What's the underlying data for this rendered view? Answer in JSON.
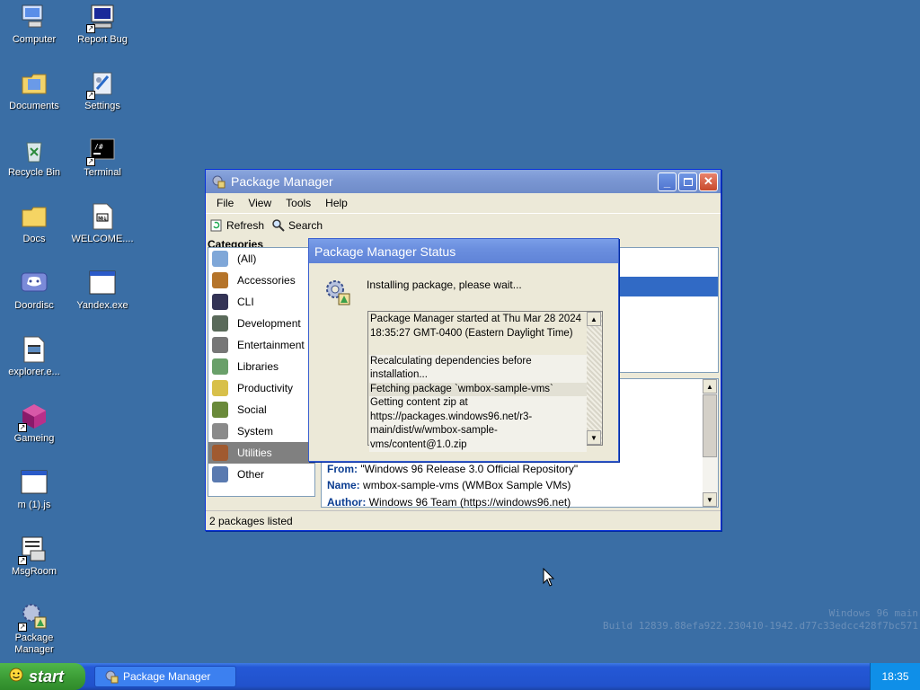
{
  "desktop": {
    "icons": [
      {
        "label": "Computer",
        "icon": "computer-icon",
        "shortcut": false
      },
      {
        "label": "Report Bug",
        "icon": "monitor-icon",
        "shortcut": true
      },
      {
        "label": "Documents",
        "icon": "documents-folder-icon",
        "shortcut": false
      },
      {
        "label": "Settings",
        "icon": "settings-icon",
        "shortcut": true
      },
      {
        "label": "Recycle Bin",
        "icon": "recycle-bin-icon",
        "shortcut": false
      },
      {
        "label": "Terminal",
        "icon": "terminal-icon",
        "shortcut": true
      },
      {
        "label": "Docs",
        "icon": "folder-icon",
        "shortcut": false
      },
      {
        "label": "WELCOME....",
        "icon": "markdown-file-icon",
        "shortcut": false
      },
      {
        "label": "Doordisc",
        "icon": "discord-icon",
        "shortcut": false
      },
      {
        "label": "Yandex.exe",
        "icon": "app-window-icon",
        "shortcut": false
      },
      {
        "label": "explorer.e...",
        "icon": "film-icon",
        "shortcut": false
      },
      {
        "label": "Gameing",
        "icon": "cube-icon",
        "shortcut": true
      },
      {
        "label": "m (1).js",
        "icon": "js-window-icon",
        "shortcut": false
      },
      {
        "label": "MsgRoom",
        "icon": "msgroom-icon",
        "shortcut": true
      },
      {
        "label": "Package Manager",
        "icon": "package-manager-icon",
        "shortcut": true
      }
    ]
  },
  "watermark": {
    "line1": "Windows 96 main",
    "line2": "Build 12839.88efa922.230410-1942.d77c33edcc428f7bc571"
  },
  "package_manager": {
    "title": "Package Manager",
    "menu": [
      "File",
      "View",
      "Tools",
      "Help"
    ],
    "toolbar": {
      "refresh": "Refresh",
      "search": "Search"
    },
    "categories_heading": "Categories",
    "categories": [
      {
        "label": "(All)",
        "icon": "all-icon",
        "color": "#7fa7d8"
      },
      {
        "label": "Accessories",
        "icon": "briefcase-icon",
        "color": "#b5742a"
      },
      {
        "label": "CLI",
        "icon": "cli-window-icon",
        "color": "#333355"
      },
      {
        "label": "Development",
        "icon": "development-icon",
        "color": "#5a6a5a"
      },
      {
        "label": "Entertainment",
        "icon": "controller-icon",
        "color": "#777777"
      },
      {
        "label": "Libraries",
        "icon": "library-icon",
        "color": "#6aa06a"
      },
      {
        "label": "Productivity",
        "icon": "notepad-icon",
        "color": "#d8c04a"
      },
      {
        "label": "Social",
        "icon": "people-icon",
        "color": "#6a8a3a"
      },
      {
        "label": "System",
        "icon": "gear-icon",
        "color": "#8a8a8a"
      },
      {
        "label": "Utilities",
        "icon": "tools-icon",
        "color": "#a05a30"
      },
      {
        "label": "Other",
        "icon": "window-icon",
        "color": "#5a7ab0"
      }
    ],
    "selected_category": "Utilities",
    "details": {
      "from_label": "From:",
      "from_value": "\"Windows 96 Release 3.0 Official Repository\"",
      "name_label": "Name:",
      "name_value": "wmbox-sample-vms (WMBox Sample VMs)",
      "author_label": "Author:",
      "author_value": "Windows 96 Team (https://windows96.net)"
    },
    "status": "2 packages listed"
  },
  "status_dialog": {
    "title": "Package Manager Status",
    "message": "Installing package, please wait...",
    "log": [
      {
        "text": "Package Manager started at Thu Mar 28 2024 18:35:27 GMT-0400 (Eastern Daylight Time)",
        "shade": "#ece9d8"
      },
      {
        "text": "",
        "shade": "#ece9d8"
      },
      {
        "text": "Recalculating dependencies before installation...",
        "shade": "#f2f1ea"
      },
      {
        "text": "Fetching package `wmbox-sample-vms`",
        "shade": "#e2e0d4"
      },
      {
        "text": "Getting content zip at https://packages.windows96.net/r3-main/dist/w/wmbox-sample-vms/content@1.0.zip",
        "shade": "#f2f1ea"
      }
    ]
  },
  "taskbar": {
    "start_label": "start",
    "task_label": "Package Manager",
    "clock": "18:35"
  }
}
